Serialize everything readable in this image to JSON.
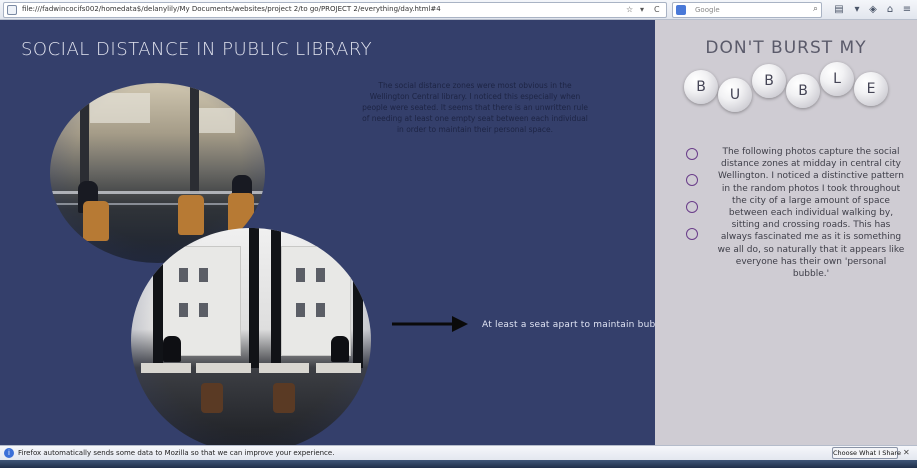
{
  "browser": {
    "url": "file:///fadwincocifs002/homedata$/delanylily/My Documents/websites/project 2/to go/PROJECT 2/everything/day.html#4",
    "search_placeholder": "Google",
    "refresh_glyph": "C",
    "dropdown_glyph": "▾",
    "star_glyph": "☆",
    "search_go_glyph": "⌕",
    "icons": [
      "home-icon",
      "bookmarks-icon",
      "menu-icon",
      "download-icon",
      "home-icon"
    ]
  },
  "left": {
    "title": "SOCIAL DISTANCE IN PUBLIC LIBRARY",
    "intro": "The social distance zones were most obvious in the Wellington Central library. I noticed this especially when people were seated. It seems that there is an unwritten rule of needing at least one empty seat between each individual in order to maintain their personal space.",
    "caption": "At least a seat apart to maintain bubbble",
    "accent_color": "#343f6b"
  },
  "right": {
    "title": "DON'T BURST MY",
    "bubble_letters": [
      "B",
      "U",
      "B",
      "B",
      "L",
      "E"
    ],
    "body": "The following photos capture the social distance zones at midday in central city Wellington. I noticed a distinctive pattern in the random photos I took throughout the city of a large amount of space between each individual walking by, sitting and crossing roads. This has always fascinated me as it is something we all do, so naturally that it appears like everyone has their own 'personal bubble.'",
    "bullet_color": "#6a3d8a",
    "background_color": "#cfccd3"
  },
  "notification": {
    "text": "Firefox automatically sends some data to Mozilla so that we can improve your experience.",
    "button_label": "Choose What I Share",
    "close_glyph": "✕"
  }
}
